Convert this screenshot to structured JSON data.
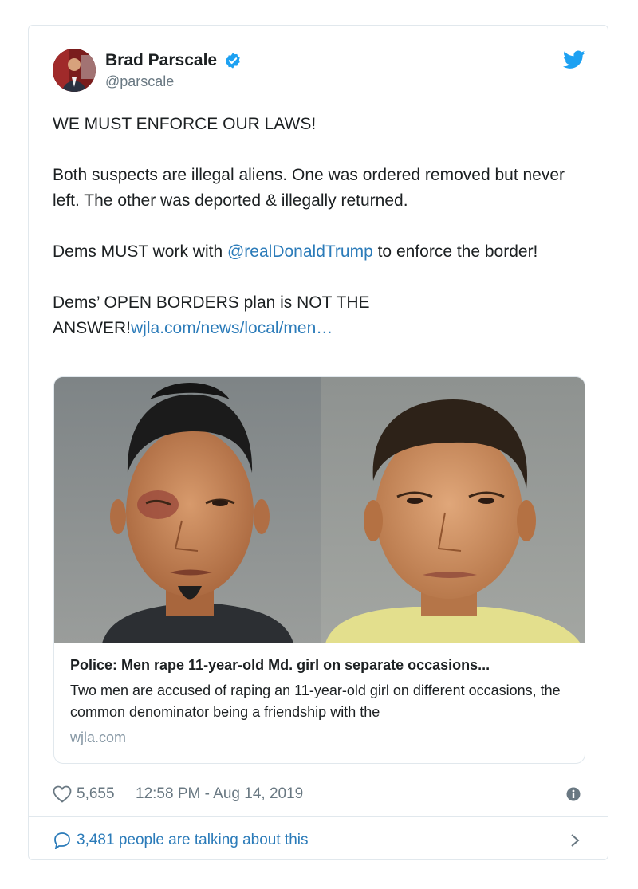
{
  "author": {
    "display_name": "Brad Parscale",
    "handle": "@parscale",
    "verified": true
  },
  "tweet": {
    "line1": "WE MUST ENFORCE OUR LAWS!",
    "line2": "Both suspects are illegal aliens. One was ordered removed but never left. The other was deported & illegally returned.",
    "line3_before": "Dems MUST work with ",
    "line3_mention": "@realDonaldTrump",
    "line3_after": " to enforce the border!",
    "line4_before": "Dems’ OPEN BORDERS plan is NOT THE ANSWER!",
    "line4_link": "wjla.com/news/local/men…"
  },
  "link_card": {
    "title": "Police: Men rape 11-year-old Md. girl on separate occasions...",
    "description": "Two men are accused of raping an 11-year-old girl on different occasions, the common denominator being a friendship with the",
    "domain": "wjla.com"
  },
  "meta": {
    "likes": "5,655",
    "timestamp": "12:58 PM - Aug 14, 2019"
  },
  "footer": {
    "talking": "3,481 people are talking about this"
  },
  "colors": {
    "link": "#2b7bb9",
    "verified": "#1da1f2",
    "muted": "#697882",
    "border": "#e1e8ed"
  }
}
